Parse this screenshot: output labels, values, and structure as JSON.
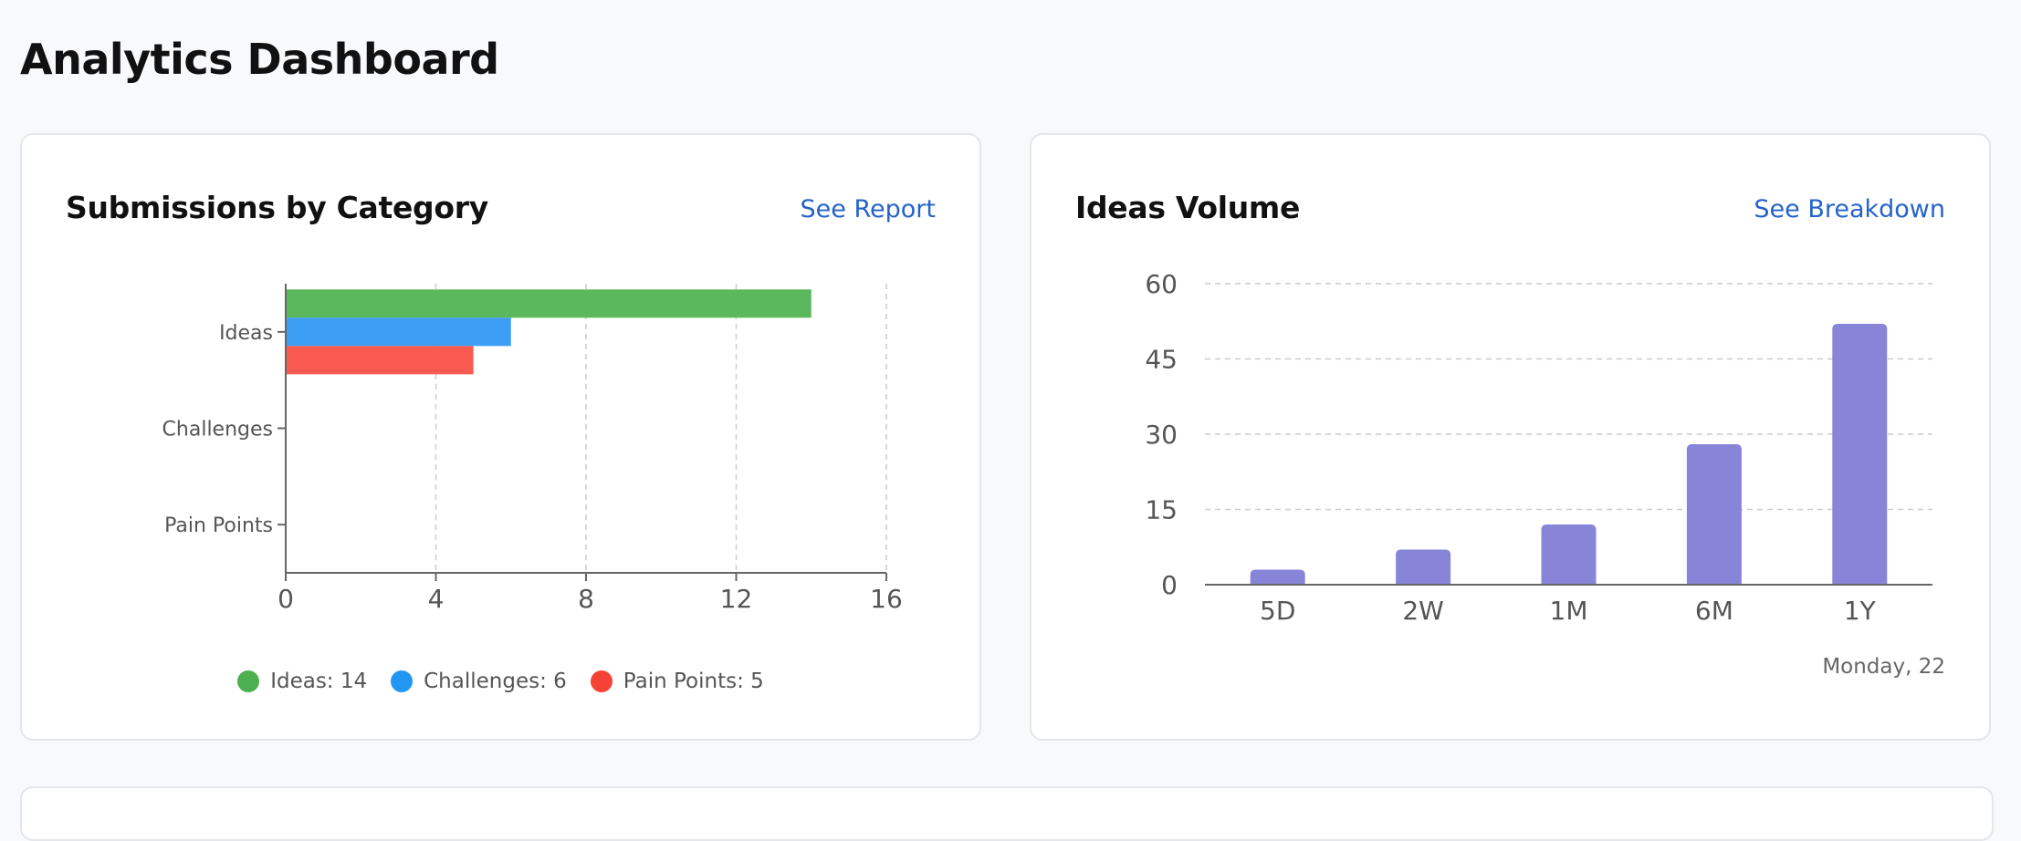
{
  "page": {
    "title": "Analytics Dashboard"
  },
  "submissions_card": {
    "title": "Submissions by Category",
    "link": "See Report",
    "legend": [
      {
        "label": "Ideas: 14",
        "color": "#4caf50"
      },
      {
        "label": "Challenges: 6",
        "color": "#2196f3"
      },
      {
        "label": "Pain Points: 5",
        "color": "#f44336"
      }
    ]
  },
  "volume_card": {
    "title": "Ideas Volume",
    "link": "See Breakdown",
    "footnote": "Monday, 22"
  },
  "chart_data": [
    {
      "type": "bar",
      "orientation": "horizontal",
      "title": "Submissions by Category",
      "categories": [
        "Ideas",
        "Challenges",
        "Pain Points"
      ],
      "series": [
        {
          "name": "Ideas",
          "values": [
            14,
            null,
            null
          ],
          "color": "#5cb85c"
        },
        {
          "name": "Challenges",
          "values": [
            6,
            null,
            null
          ],
          "color": "#3c9ef5"
        },
        {
          "name": "Pain Points",
          "values": [
            5,
            null,
            null
          ],
          "color": "#fa5a50"
        }
      ],
      "xlim": [
        0,
        16
      ],
      "xticks": [
        0,
        4,
        8,
        12,
        16
      ],
      "grid": true,
      "legend_position": "bottom"
    },
    {
      "type": "bar",
      "title": "Ideas Volume",
      "categories": [
        "5D",
        "2W",
        "1M",
        "6M",
        "1Y"
      ],
      "values": [
        3,
        7,
        12,
        28,
        52
      ],
      "color": "#8884d8",
      "ylim": [
        0,
        60
      ],
      "yticks": [
        0,
        15,
        30,
        45,
        60
      ],
      "grid": true
    }
  ]
}
